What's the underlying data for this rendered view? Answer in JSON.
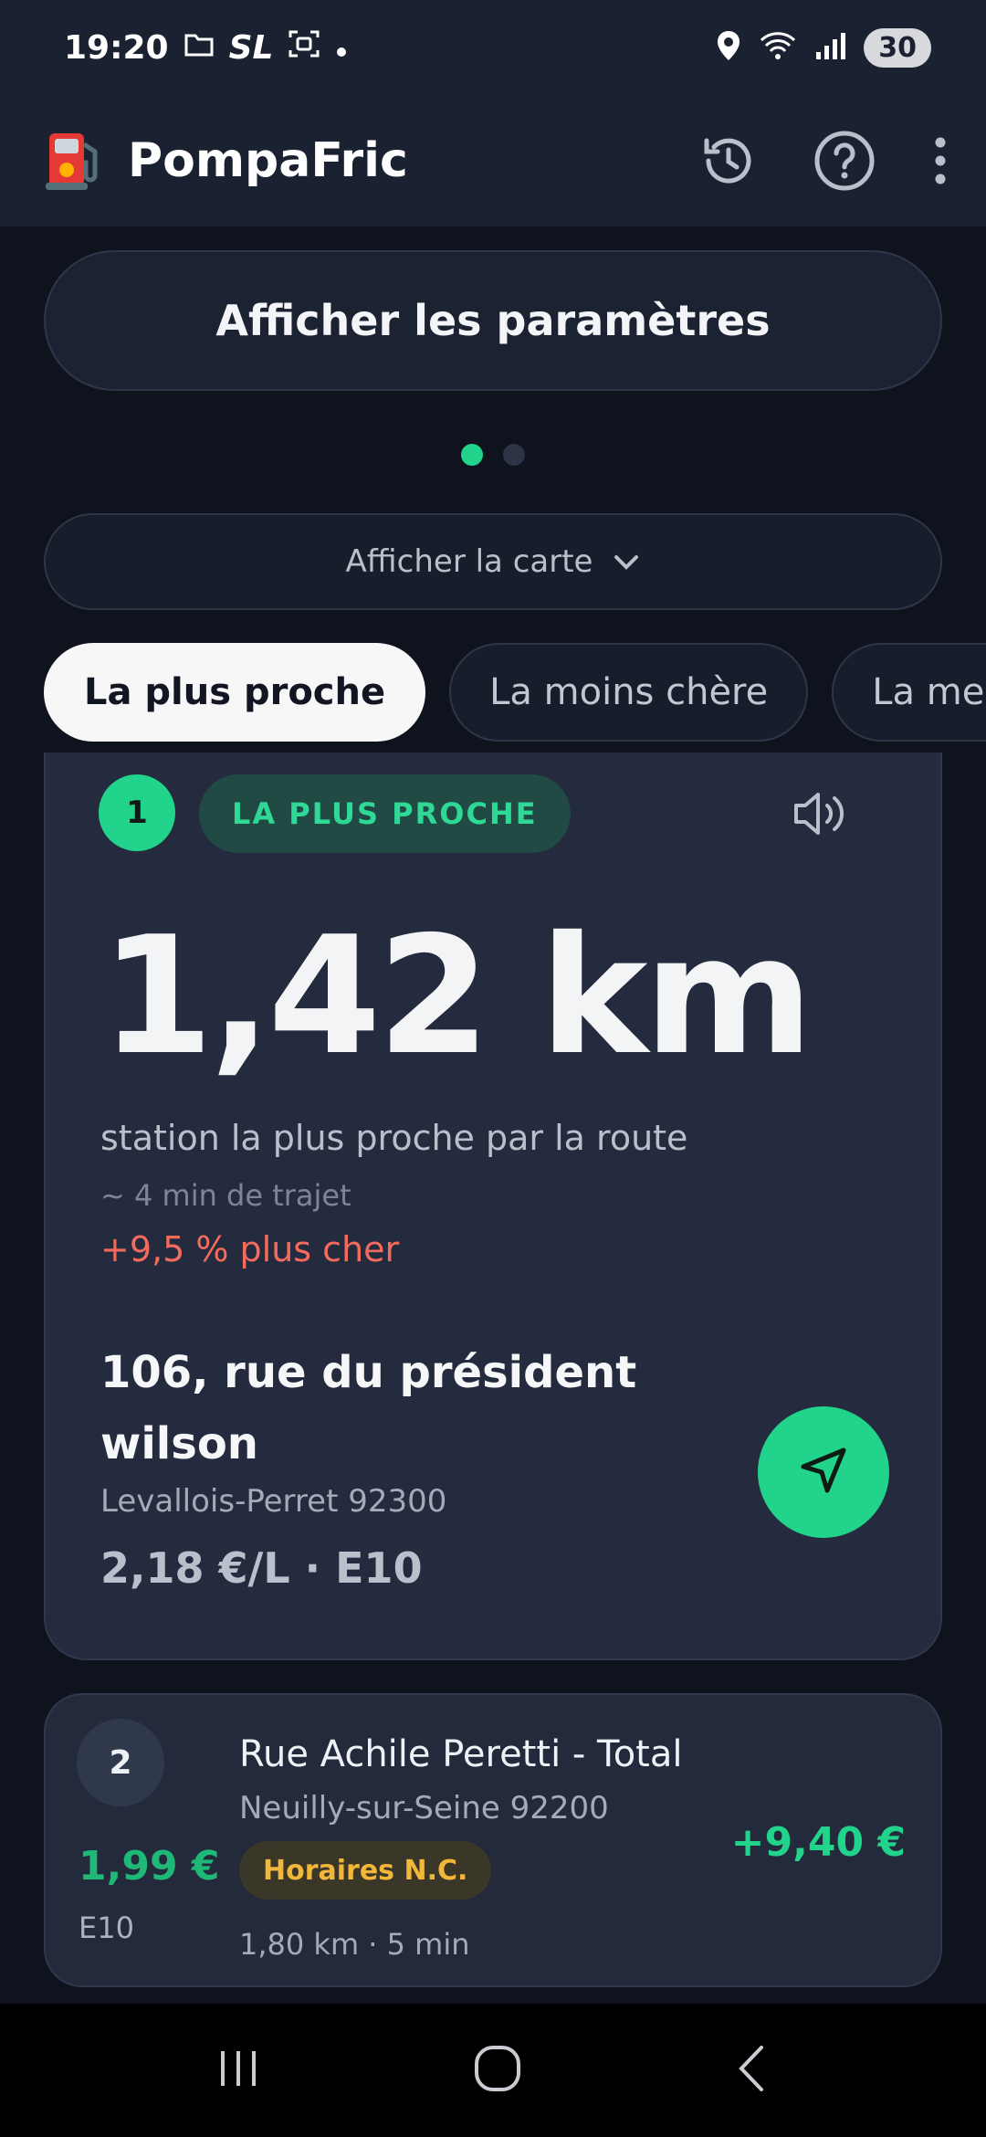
{
  "status_bar": {
    "time": "19:20",
    "carrier": "SL",
    "battery": "30",
    "icons": [
      "folder-icon",
      "screen-record-icon",
      "dot-icon",
      "location-icon",
      "wifi-icon",
      "signal-icon",
      "battery-icon"
    ]
  },
  "app_bar": {
    "title": "PompaFric",
    "logo_icon": "fuel-pump-icon",
    "actions": [
      "history-icon",
      "help-icon",
      "more-vert-icon"
    ]
  },
  "settings_button": {
    "label": "Afficher les paramètres"
  },
  "pager": {
    "count": 2,
    "active": 0
  },
  "map_toggle": {
    "label": "Afficher la carte",
    "icon": "chevron-down-icon"
  },
  "tabs": [
    {
      "label": "La plus proche",
      "active": true
    },
    {
      "label": "La moins chère",
      "active": false
    },
    {
      "label": "La meilleu",
      "active": false
    }
  ],
  "primary_station": {
    "rank": "1",
    "badge": "LA PLUS PROCHE",
    "distance": "1,42 km",
    "description": "station la plus proche par la route",
    "travel_time": "~ 4 min de trajet",
    "price_diff": "+9,5 % plus cher",
    "address": "106, rue du président wilson",
    "city": "Levallois-Perret 92300",
    "price_fuel": "2,18 €/L · E10",
    "colors": {
      "accent": "#22d38b",
      "warning": "#f46b5d"
    }
  },
  "secondary_station": {
    "rank": "2",
    "price": "1,99 €",
    "fuel": "E10",
    "name": "Rue Achile Peretti - Total",
    "city": "Neuilly-sur-Seine 92200",
    "hours_badge": "Horaires N.C.",
    "distance_time": "1,80 km · 5 min",
    "saving": "+9,40 €"
  },
  "nav_bar": [
    "recents-icon",
    "home-icon",
    "back-icon"
  ]
}
